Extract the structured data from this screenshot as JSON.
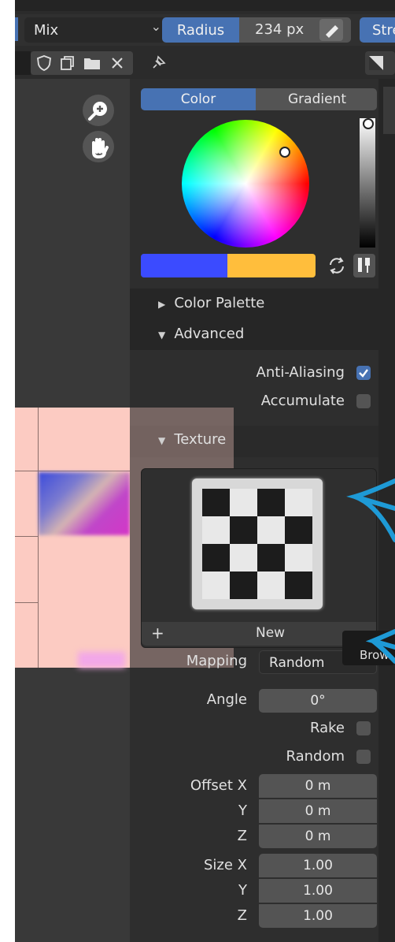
{
  "toolbar": {
    "blend_mode": "Mix",
    "radius_label": "Radius",
    "radius_value": "234 px",
    "strength_label": "Stre"
  },
  "color_tabs": {
    "color": "Color",
    "gradient": "Gradient"
  },
  "colors": {
    "primary": "#3b4bff",
    "secondary": "#ffbe3c",
    "accent": "#4772b3"
  },
  "sections": {
    "color_palette": "Color Palette",
    "advanced": "Advanced",
    "texture": "Texture"
  },
  "advanced": {
    "anti_aliasing": {
      "label": "Anti-Aliasing",
      "checked": true
    },
    "accumulate": {
      "label": "Accumulate",
      "checked": false
    }
  },
  "texture": {
    "new_label": "New",
    "browse_tooltip": "Brow",
    "mapping_label": "Mapping",
    "mapping_value": "Random",
    "angle_label": "Angle",
    "angle_value": "0°",
    "rake_label": "Rake",
    "random_label": "Random",
    "offset_label": "Offset X",
    "offset_x": "0 m",
    "offset_y": "0 m",
    "offset_z": "0 m",
    "size_label": "Size X",
    "size_x": "1.00",
    "size_y": "1.00",
    "size_z": "1.00",
    "y_label": "Y",
    "z_label": "Z"
  },
  "icons": [
    "zoom-icon",
    "hand-icon",
    "shield-icon",
    "duplicate-icon",
    "folder-icon",
    "close-icon",
    "pin-icon",
    "swap-icon",
    "eyedropper-icon",
    "image-type-icon"
  ]
}
